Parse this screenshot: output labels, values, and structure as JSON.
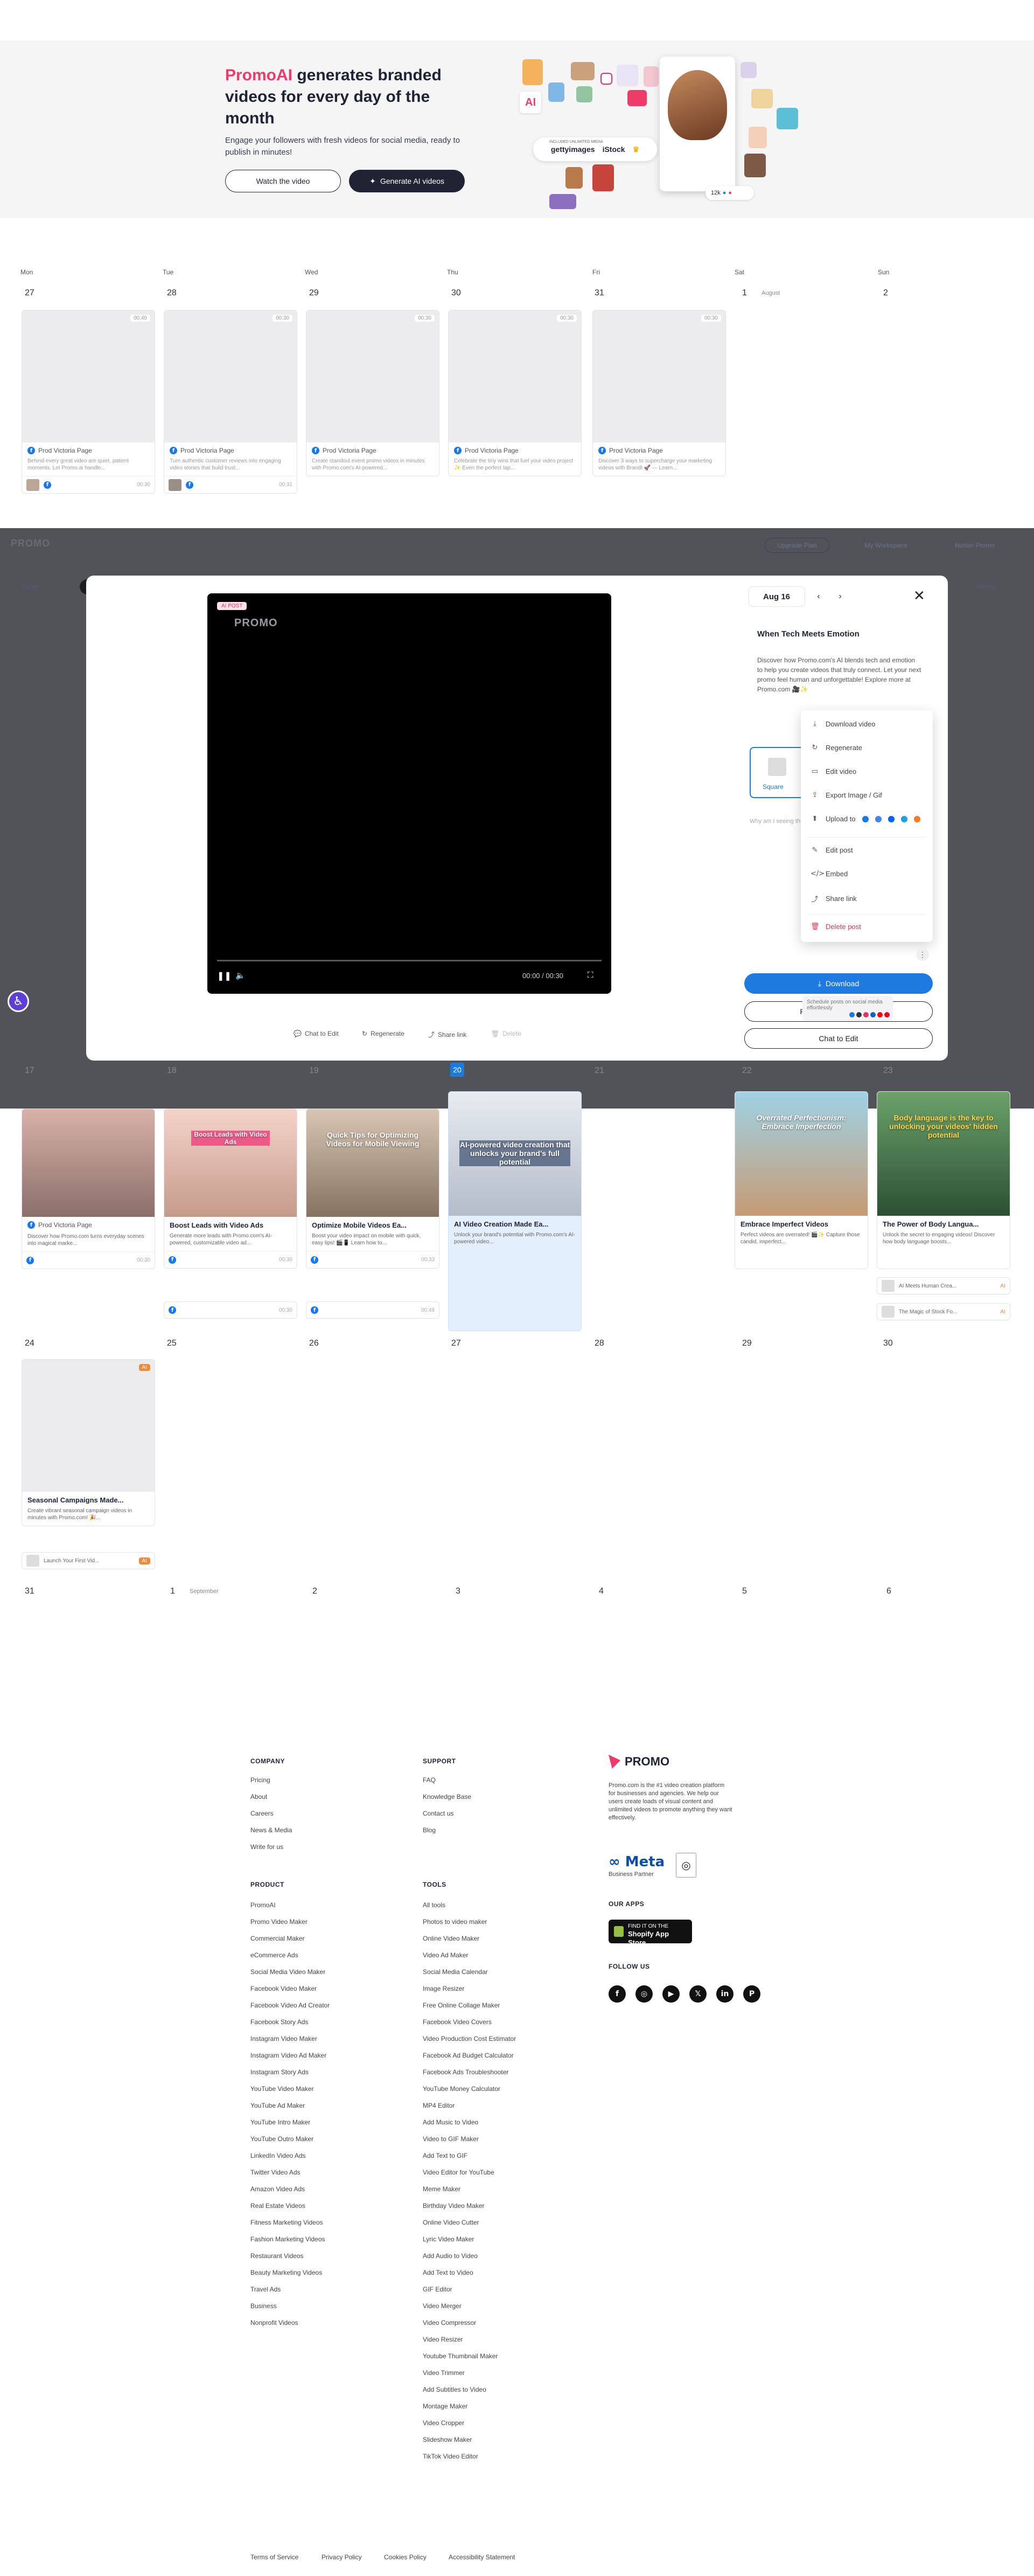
{
  "hero": {
    "title_accent": "PromoAI",
    "title_rest": " generates branded videos for every day of the month",
    "description": "Engage your followers with fresh videos for social media, ready to publish in minutes!",
    "watch_label": "Watch the video",
    "generate_label": "Generate AI videos",
    "collage": {
      "getty": "gettyimages",
      "istock": "iStock",
      "unlimited_note": "INCLUDED UNLIMITED MEDIA",
      "counter": "12k"
    }
  },
  "calendar": {
    "weekdays": [
      "Mon",
      "Tue",
      "Wed",
      "Thu",
      "Fri",
      "Sat",
      "Sun"
    ],
    "week1_days": [
      "27",
      "28",
      "29",
      "30",
      "31",
      "1",
      "2"
    ],
    "week1_month": "August",
    "week1_cards": [
      {
        "page": "Prod Victoria Page",
        "desc": "Behind every great video are quiet, patient moments. Let Promo.ai handle...",
        "dur": "00:40",
        "time": "00:30"
      },
      {
        "page": "Prod Victoria Page",
        "desc": "Turn authentic customer reviews into engaging video stories that build trust...",
        "dur": "00:30",
        "time": "00:31"
      },
      {
        "page": "Prod Victoria Page",
        "desc": "Create standout event promo videos in minutes with Promo.com's AI-powered...",
        "dur": "00:30",
        "time": ""
      },
      {
        "page": "Prod Victoria Page",
        "desc": "Celebrate the tiny wins that fuel your video project ✨ Even the perfect tap...",
        "dur": "00:30",
        "time": ""
      },
      {
        "page": "Prod Victoria Page",
        "desc": "Discover 3 ways to supercharge your marketing videos with Brandt 🚀 — Learn...",
        "dur": "00:30",
        "time": ""
      }
    ],
    "week3_days": [
      "17",
      "18",
      "19",
      "20",
      "21",
      "22",
      "23"
    ],
    "week3_cards": [
      {
        "title": "Prod Victoria Page",
        "desc": "Discover how Promo.com turns everyday scenes into magical marke...",
        "time": "00:30",
        "image_text": ""
      },
      {
        "title": "Boost Leads with Video Ads",
        "desc": "Generate more leads with Promo.com's AI-powered, customizable video ad...",
        "time": "00:30",
        "image_text": "Boost Leads with Video Ads"
      },
      {
        "title": "Optimize Mobile Videos Ea...",
        "desc": "Boost your video impact on mobile with quick, easy tips! 🎬📱 Learn how to...",
        "time": "00:33",
        "image_text": "Quick Tips for Optimizing Videos for Mobile Viewing"
      },
      {
        "title": "AI Video Creation Made Ea...",
        "desc": "Unlock your brand's potential with Promo.com's AI-powered video...",
        "time": "",
        "image_text": "AI-powered video creation that unlocks your brand's full potential"
      },
      {
        "title": "Embrace Imperfect Videos",
        "desc": "Perfect videos are overrated! 🎬✨ Capture those candid, imperfect...",
        "time": "",
        "image_text": "Overrated Perfectionism: Embrace Imperfection"
      },
      {
        "title": "The Power of Body Langua...",
        "desc": "Unlock the secret to engaging videos! Discover how body language boosts...",
        "time": "",
        "image_text": "Body language is the key to unlocking your videos' hidden potential"
      }
    ],
    "sub_rows": [
      {
        "time": "00:30"
      },
      {
        "time": "00:49"
      }
    ],
    "body_sub": [
      {
        "title": "AI Meets Human Crea...",
        "tag": "AI"
      },
      {
        "title": "The Magic of Stock Fo...",
        "tag": "AI"
      }
    ],
    "week4_days": [
      "24",
      "25",
      "26",
      "27",
      "28",
      "29",
      "30"
    ],
    "week4_card": {
      "title": "Seasonal Campaigns Made...",
      "desc": "Create vibrant seasonal campaign videos in minutes with Promo.com! 🎉...",
      "tag": "AI",
      "sub_title": "Launch Your First Vid...",
      "sub_tag": "AI"
    },
    "week5_days": [
      "31",
      "1",
      "2",
      "3",
      "4",
      "5",
      "6"
    ],
    "week5_month": "September"
  },
  "backdrop": {
    "logo": "PROMO",
    "pill_upgrade": "Upgrade Plan",
    "pill_workspace": "My Workspace",
    "pill_user": "Nurlan Promo",
    "today": "Today",
    "month": "Month"
  },
  "modal": {
    "ai_badge": "AI POST",
    "watermark": "PROMO",
    "time": "00:00 / 00:30",
    "date": "Aug 16",
    "title": "When Tech Meets Emotion",
    "body": "Discover how Promo.com's AI blends tech and emotion to help you create videos that truly connect. Let your next promo feel human and unforgettable! Explore more at Promo.com 🎥✨",
    "format_label": "Square",
    "sm_note": "Why am I seeing this?",
    "video_actions": {
      "chat": "Chat to Edit",
      "regenerate": "Regenerate",
      "share": "Share link",
      "delete": "Delete"
    },
    "menu": {
      "download": "Download video",
      "regenerate": "Regenerate",
      "edit_video": "Edit video",
      "export": "Export Image / Gif",
      "upload": "Upload to",
      "edit_post": "Edit post",
      "embed": "Embed",
      "share": "Share link",
      "delete": "Delete post"
    },
    "download_label": "Download",
    "publish_label": "Publish to social media",
    "chat_label": "Chat to Edit",
    "tooltip": "Schedule posts on social media effortlessly"
  },
  "footer": {
    "company_head": "COMPANY",
    "company": [
      "Pricing",
      "About",
      "Careers",
      "News & Media",
      "Write for us"
    ],
    "support_head": "SUPPORT",
    "support": [
      "FAQ",
      "Knowledge Base",
      "Contact us",
      "Blog"
    ],
    "product_head": "PRODUCT",
    "product": [
      "PromoAI",
      "Promo Video Maker",
      "Commercial Maker",
      "eCommerce Ads",
      "Social Media Video Maker",
      "Facebook Video Maker",
      "Facebook Video Ad Creator",
      "Facebook Story Ads",
      "Instagram Video Maker",
      "Instagram Video Ad Maker",
      "Instagram Story Ads",
      "YouTube Video Maker",
      "YouTube Ad Maker",
      "YouTube Intro Maker",
      "YouTube Outro Maker",
      "LinkedIn Video Ads",
      "Twitter Video Ads",
      "Amazon Video Ads",
      "Real Estate Videos",
      "Fitness Marketing Videos",
      "Fashion Marketing Videos",
      "Restaurant Videos",
      "Beauty Marketing Videos",
      "Travel Ads",
      "Business",
      "Nonprofit Videos"
    ],
    "tools_head": "TOOLS",
    "tools": [
      "All tools",
      "Photos to video maker",
      "Online Video Maker",
      "Video Ad Maker",
      "Social Media Calendar",
      "Image Resizer",
      "Free Online Collage Maker",
      "Facebook Video Covers",
      "Video Production Cost Estimator",
      "Facebook Ad Budget Calculator",
      "Facebook Ads Troubleshooter",
      "YouTube Money Calculator",
      "MP4 Editor",
      "Add Music to Video",
      "Video to GIF Maker",
      "Add Text to GIF",
      "Video Editor for YouTube",
      "Meme Maker",
      "Birthday Video Maker",
      "Online Video Cutter",
      "Lyric Video Maker",
      "Add Audio to Video",
      "Add Text to Video",
      "GIF Editor",
      "Video Merger",
      "Video Compressor",
      "Video Resizer",
      "Youtube Thumbnail Maker",
      "Video Trimmer",
      "Add Subtitles to Video",
      "Montage Maker",
      "Video Cropper",
      "Slideshow Maker",
      "TikTok Video Editor"
    ],
    "logo": "PROMO",
    "about": "Promo.com is the #1 video creation platform for businesses and agencies. We help our users create loads of visual content and unlimited videos to promote anything they want effectively.",
    "meta": "Meta",
    "meta_sub": "Business Partner",
    "apps_head": "OUR APPS",
    "shopify_small": "FIND IT ON THE",
    "shopify_big": "Shopify App Store",
    "follow_head": "FOLLOW US",
    "social": [
      "facebook-icon",
      "instagram-icon",
      "youtube-icon",
      "x-icon",
      "linkedin-icon",
      "pinterest-icon"
    ],
    "legal": [
      "Terms of Service",
      "Privacy Policy",
      "Cookies Policy",
      "Accessibility Statement"
    ]
  },
  "colors": {
    "accent": "#ee3b6a",
    "blue": "#1f7ae0",
    "dark": "#1f2333"
  }
}
